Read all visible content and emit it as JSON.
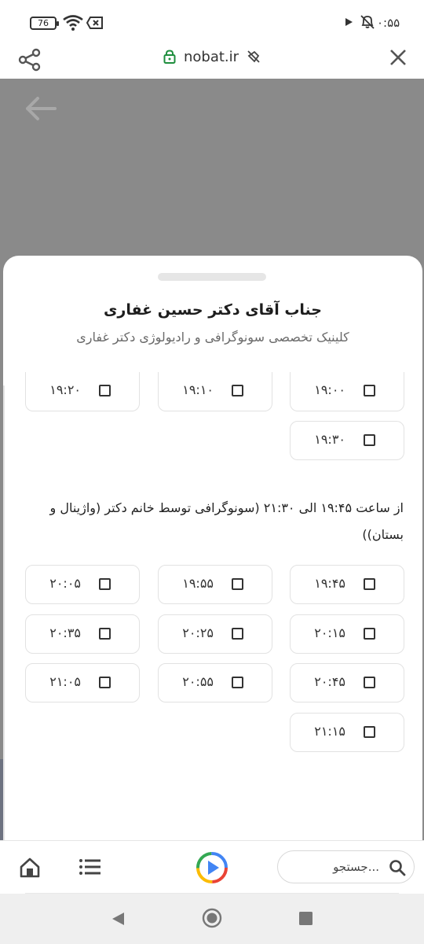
{
  "status_bar": {
    "battery": "76",
    "clock": "۰:۵۵"
  },
  "browser": {
    "url": "nobat.ir"
  },
  "sheet": {
    "title": "جناب آقای دکتر حسین غفاری",
    "subtitle": "کلینیک تخصصی سونوگرافی و رادیولوژی دکتر غفاری",
    "slots_group1": [
      "۱۹:۰۰",
      "۱۹:۱۰",
      "۱۹:۲۰",
      "۱۹:۳۰"
    ],
    "section2_desc": "از ساعت ۱۹:۴۵ الی ۲۱:۳۰ (سونوگرافی توسط خانم دکتر (واژینال و بستان))",
    "slots_group2": [
      "۱۹:۴۵",
      "۱۹:۵۵",
      "۲۰:۰۵",
      "۲۰:۱۵",
      "۲۰:۲۵",
      "۲۰:۳۵",
      "۲۰:۴۵",
      "۲۰:۵۵",
      "۲۱:۰۵",
      "۲۱:۱۵"
    ]
  },
  "toolbar": {
    "search_placeholder": "جستجو..."
  },
  "icons": {
    "status": [
      "wifi-icon",
      "x-box-icon",
      "play-small-icon",
      "mute-icon"
    ],
    "browser": [
      "share-icon",
      "lock-icon",
      "nofollow-icon",
      "close-icon",
      "back-arrow-icon"
    ],
    "toolbar": [
      "home-icon",
      "list-icon",
      "play-logo-icon",
      "search-icon"
    ],
    "nav": [
      "nav-back-icon",
      "nav-home-icon",
      "nav-recent-icon"
    ]
  }
}
